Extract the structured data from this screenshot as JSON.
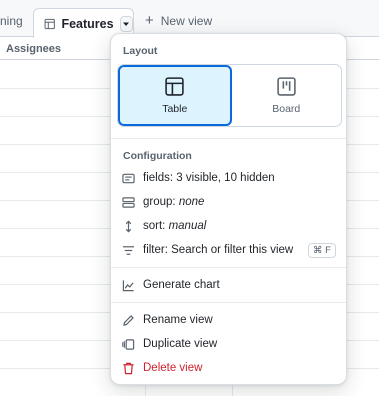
{
  "tabs": {
    "previous_partial": "ning",
    "active_label": "Features",
    "new_view_label": "New view"
  },
  "table": {
    "column_header": "Assignees"
  },
  "menu": {
    "layout_title": "Layout",
    "layout_options": [
      {
        "label": "Table",
        "icon": "table-icon",
        "selected": true
      },
      {
        "label": "Board",
        "icon": "board-icon",
        "selected": false
      }
    ],
    "configuration_title": "Configuration",
    "fields_label": "fields:",
    "fields_value": "3 visible, 10 hidden",
    "group_label": "group:",
    "group_value": "none",
    "sort_label": "sort:",
    "sort_value": "manual",
    "filter_label": "filter:",
    "filter_value": "Search or filter this view",
    "filter_shortcut": "⌘ F",
    "generate_chart": "Generate chart",
    "rename_view": "Rename view",
    "duplicate_view": "Duplicate view",
    "delete_view": "Delete view"
  },
  "colors": {
    "accent": "#0969da",
    "selected_bg": "#ddf4ff",
    "danger": "#cf222e",
    "muted_text": "#59636e"
  }
}
